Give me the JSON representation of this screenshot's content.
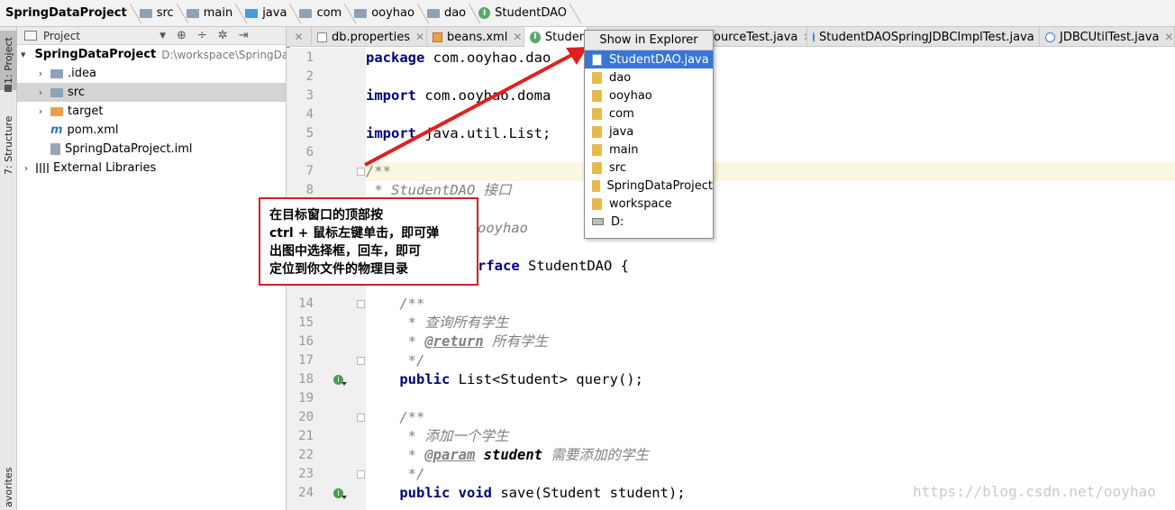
{
  "breadcrumbs": [
    {
      "label": "SpringDataProject",
      "icon": "project-icon",
      "bold": true
    },
    {
      "label": "src",
      "icon": "folder-icon"
    },
    {
      "label": "main",
      "icon": "folder-icon"
    },
    {
      "label": "java",
      "icon": "folder-blue-icon"
    },
    {
      "label": "com",
      "icon": "folder-icon"
    },
    {
      "label": "ooyhao",
      "icon": "folder-icon"
    },
    {
      "label": "dao",
      "icon": "folder-icon"
    },
    {
      "label": "StudentDAO",
      "icon": "interface-icon"
    }
  ],
  "side_tabs": {
    "project": "1: Project",
    "structure": "7: Structure",
    "favorites": "avorites"
  },
  "project_panel": {
    "title": "Project",
    "tree": [
      {
        "label": "SpringDataProject",
        "path": "D:\\workspace\\SpringDa",
        "bold": true,
        "expanded": true
      },
      {
        "label": ".idea"
      },
      {
        "label": "src"
      },
      {
        "label": "target"
      },
      {
        "label": "pom.xml"
      },
      {
        "label": "SpringDataProject.iml"
      },
      {
        "label": "External Libraries"
      }
    ]
  },
  "editor_tabs": [
    {
      "label": "db.properties"
    },
    {
      "label": "beans.xml"
    },
    {
      "label": "Studen"
    },
    {
      "label": "ourceTest.java"
    },
    {
      "label": "StudentDAOSpringJDBCImplTest.java"
    },
    {
      "label": "JDBCUtilTest.java"
    }
  ],
  "line_numbers": [
    "1",
    "2",
    "3",
    "4",
    "5",
    "6",
    "7",
    "8",
    "",
    "",
    "",
    "",
    "",
    "14",
    "15",
    "16",
    "17",
    "18",
    "19",
    "20",
    "21",
    "22",
    "23",
    "24"
  ],
  "code": {
    "l1_kw": "package",
    "l1_rest": " com.ooyhao.dao",
    "l3_kw": "import",
    "l3_rest": " com.ooyhao.doma",
    "l5_kw": "import",
    "l5_rest": " java.util.List;",
    "l7": "/**",
    "l8": " * StudentDAO 接口",
    "l10": "ooyhao",
    "l12_kw": "rface",
    "l12_rest": " StudentDAO {",
    "l14": "    /**",
    "l15": "     * 查询所有学生",
    "l16_pre": "     * ",
    "l16_tag": "@return",
    "l16_post": " 所有学生",
    "l17": "     */",
    "l18_kw": "    public",
    "l18_rest": " List<Student> query();",
    "l20": "    /**",
    "l21": "     * 添加一个学生",
    "l22_pre": "     * ",
    "l22_tag": "@param",
    "l22_param": " student",
    "l22_post": " 需要添加的学生",
    "l23": "     */",
    "l24_kw1": "    public",
    "l24_kw2": " void",
    "l24_rest": " save(Student student);"
  },
  "popup": {
    "title": "Show in Explorer",
    "items": [
      {
        "label": "StudentDAO.java",
        "type": "file",
        "selected": true
      },
      {
        "label": "dao",
        "type": "folder"
      },
      {
        "label": "ooyhao",
        "type": "folder"
      },
      {
        "label": "com",
        "type": "folder"
      },
      {
        "label": "java",
        "type": "folder"
      },
      {
        "label": "main",
        "type": "folder"
      },
      {
        "label": "src",
        "type": "folder"
      },
      {
        "label": "SpringDataProject",
        "type": "folder"
      },
      {
        "label": "workspace",
        "type": "folder"
      },
      {
        "label": "D:",
        "type": "drive"
      }
    ]
  },
  "annotation": {
    "line1": "在目标窗口的顶部按",
    "line2": "ctrl + 鼠标左键单击，即可弹",
    "line3": "出图中选择框，回车，即可",
    "line4": "定位到你文件的物理目录"
  },
  "watermark": "https://blog.csdn.net/ooyhao",
  "colors": {
    "keyword": "#000080",
    "comment": "#808080",
    "selection": "#3875d7",
    "annotation_border": "#d42020",
    "arrow": "#e02020",
    "current_line": "#fbf6df"
  }
}
